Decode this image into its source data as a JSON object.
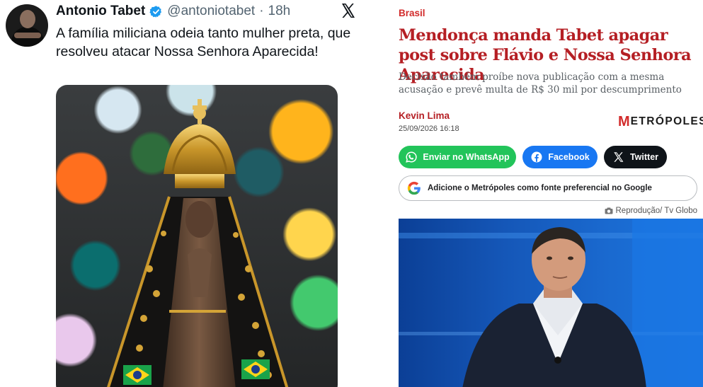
{
  "tweet": {
    "author_name": "Antonio Tabet",
    "handle": "@antoniotabet",
    "separator": "·",
    "time": "18h",
    "text": "A família miliciana odeia tanto mulher preta, que resolveu atacar Nossa Senhora Aparecida!",
    "verified_color": "#1d9bf0",
    "icons": [
      "verified-badge-icon",
      "x-logo-icon"
    ]
  },
  "article": {
    "section": "Brasil",
    "headline": "Mendonça manda Tabet apagar post sobre Flávio e Nossa Senhora Aparecida",
    "subheadline": "Decisão também proíbe nova publicação com a mesma acusação e prevê multa de R$ 30 mil por descumprimento",
    "author": "Kevin Lima",
    "date": "25/09/2026 16:18",
    "brand_initial": "M",
    "brand_rest": "ETRÓPOLES",
    "share_buttons": [
      {
        "label": "Enviar no WhatsApp",
        "icon": "whatsapp-icon",
        "color": "#22c45a"
      },
      {
        "label": "Facebook",
        "icon": "facebook-icon",
        "color": "#1877f2"
      },
      {
        "label": "Twitter",
        "icon": "x-icon",
        "color": "#0f1419"
      }
    ],
    "google_cta": "Adicione o Metrópoles como fonte preferencial no Google",
    "photo_credit": "Reprodução/ Tv Globo",
    "accent_color": "#b51f24"
  }
}
